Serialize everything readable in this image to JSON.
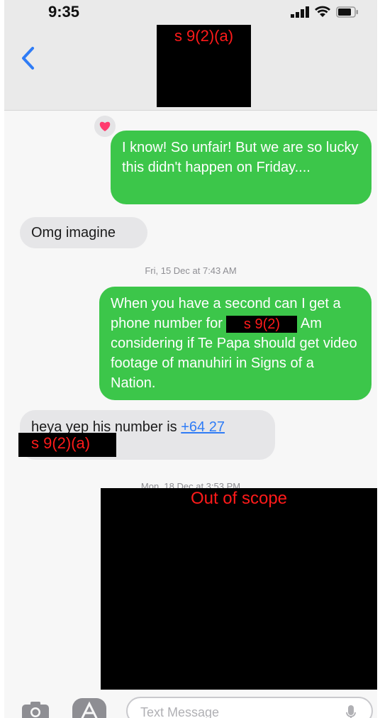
{
  "status_bar": {
    "time": "9:35"
  },
  "header": {
    "contact_redaction": "s 9(2)(a)"
  },
  "messages": [
    {
      "direction": "outgoing",
      "text": "I know! So unfair! But we are so lucky this didn't happen on Friday....",
      "reaction": "heart"
    },
    {
      "direction": "incoming",
      "text": "Omg imagine"
    },
    {
      "type": "timestamp",
      "text": "Fri, 15 Dec at 7:43 AM"
    },
    {
      "direction": "outgoing",
      "text_before": "When you have a second can I get a phone number for",
      "redaction": "s 9(2)",
      "text_after": "Am considering if Te Papa should get video footage of manuhiri in Signs of a Nation."
    },
    {
      "direction": "incoming",
      "text_before": "heya yep his number is",
      "link": "+64 27",
      "redaction": "s 9(2)(a)"
    },
    {
      "type": "timestamp",
      "text": "Mon, 18 Dec at 3:53 PM"
    }
  ],
  "out_of_scope_label": "Out of scope",
  "composer": {
    "placeholder": "Text Message"
  },
  "colors": {
    "outgoing_bubble": "#3cc64a",
    "incoming_bubble": "#e6e6e8",
    "link": "#2f7cf6",
    "redaction_text": "#ff1a1a"
  }
}
